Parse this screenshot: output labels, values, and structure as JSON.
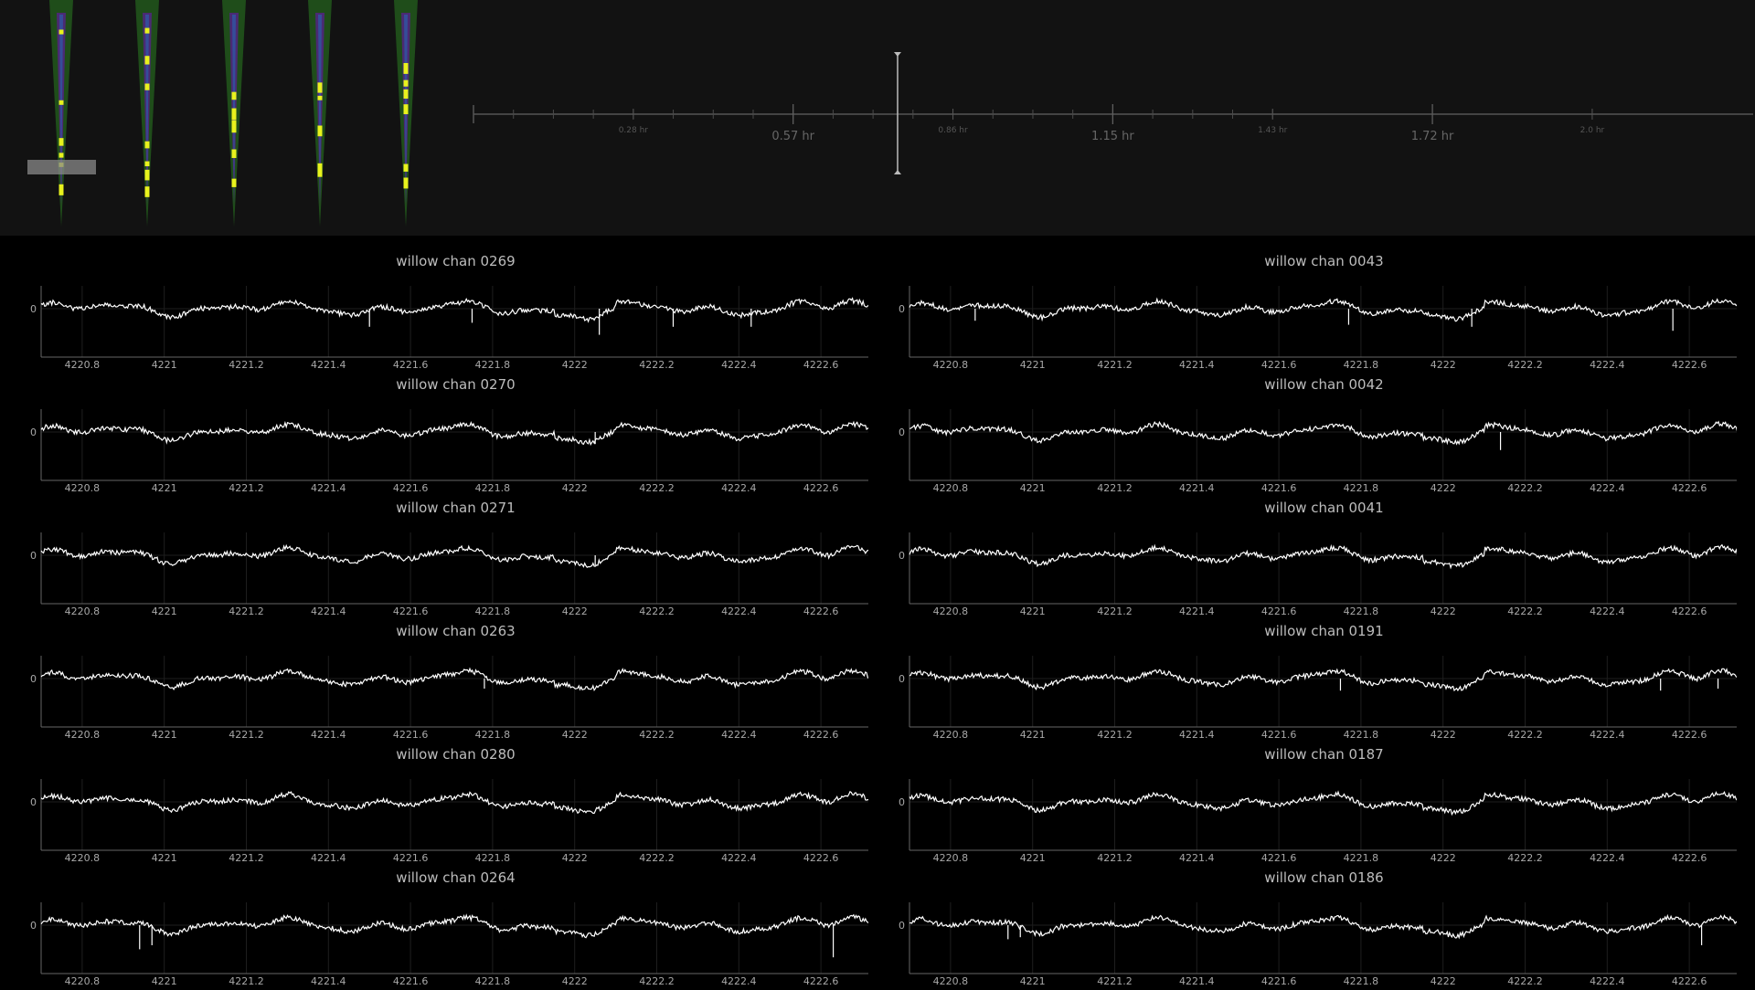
{
  "colors": {
    "background": "#000000",
    "top_panel": "#121212",
    "trace": "#ffffff",
    "axis": "#666666",
    "tick_text": "#a8a8a8",
    "probe_green": "#1f4d1a",
    "probe_purple": "#4b2a73",
    "probe_blue": "#2f56a3",
    "probe_yellow": "#e8f21d"
  },
  "probes": {
    "count": 5,
    "selection_box": true
  },
  "timeline": {
    "major_labels": [
      "0.57 hr",
      "1.15 hr",
      "1.72 hr"
    ],
    "minor_labels": [
      "0.28 hr",
      "0.86 hr",
      "1.43 hr",
      "2.0 hr"
    ],
    "cursor_value_hr": 0.76
  },
  "chart_data": [
    {
      "type": "line",
      "title": "willow chan 0269",
      "xlim": [
        4220.7,
        4222.72
      ],
      "ytick": "0",
      "x_ticks": [
        "4220.8",
        "4221",
        "4221.2",
        "4221.4",
        "4221.6",
        "4221.8",
        "4222",
        "4222.2",
        "4222.4",
        "4222.6"
      ],
      "seed": 11,
      "spikes": [
        [
          4221.5,
          0.9
        ],
        [
          4221.75,
          0.7
        ],
        [
          4222.06,
          1.3
        ],
        [
          4222.24,
          0.9
        ],
        [
          4222.43,
          0.9
        ]
      ]
    },
    {
      "type": "line",
      "title": "willow chan 0043",
      "xlim": [
        4220.7,
        4222.72
      ],
      "ytick": "0",
      "x_ticks": [
        "4220.8",
        "4221",
        "4221.2",
        "4221.4",
        "4221.6",
        "4221.8",
        "4222",
        "4222.2",
        "4222.4",
        "4222.6"
      ],
      "seed": 12,
      "spikes": [
        [
          4220.86,
          0.6
        ],
        [
          4221.77,
          0.8
        ],
        [
          4222.07,
          0.9
        ],
        [
          4222.56,
          1.1
        ]
      ]
    },
    {
      "type": "line",
      "title": "willow chan 0270",
      "xlim": [
        4220.7,
        4222.72
      ],
      "ytick": "0",
      "x_ticks": [
        "4220.8",
        "4221",
        "4221.2",
        "4221.4",
        "4221.6",
        "4221.8",
        "4222",
        "4222.2",
        "4222.4",
        "4222.6"
      ],
      "seed": 13,
      "spikes": [
        [
          4222.05,
          0.6
        ]
      ]
    },
    {
      "type": "line",
      "title": "willow chan 0042",
      "xlim": [
        4220.7,
        4222.72
      ],
      "ytick": "0",
      "x_ticks": [
        "4220.8",
        "4221",
        "4221.2",
        "4221.4",
        "4221.6",
        "4221.8",
        "4222",
        "4222.2",
        "4222.4",
        "4222.6"
      ],
      "seed": 14,
      "spikes": [
        [
          4222.14,
          0.9
        ]
      ]
    },
    {
      "type": "line",
      "title": "willow chan 0271",
      "xlim": [
        4220.7,
        4222.72
      ],
      "ytick": "0",
      "x_ticks": [
        "4220.8",
        "4221",
        "4221.2",
        "4221.4",
        "4221.6",
        "4221.8",
        "4222",
        "4222.2",
        "4222.4",
        "4222.6"
      ],
      "seed": 15,
      "spikes": [
        [
          4222.05,
          0.5
        ]
      ]
    },
    {
      "type": "line",
      "title": "willow chan 0041",
      "xlim": [
        4220.7,
        4222.72
      ],
      "ytick": "0",
      "x_ticks": [
        "4220.8",
        "4221",
        "4221.2",
        "4221.4",
        "4221.6",
        "4221.8",
        "4222",
        "4222.2",
        "4222.4",
        "4222.6"
      ],
      "seed": 16,
      "spikes": []
    },
    {
      "type": "line",
      "title": "willow chan 0263",
      "xlim": [
        4220.7,
        4222.72
      ],
      "ytick": "0",
      "x_ticks": [
        "4220.8",
        "4221",
        "4221.2",
        "4221.4",
        "4221.6",
        "4221.8",
        "4222",
        "4222.2",
        "4222.4",
        "4222.6"
      ],
      "seed": 17,
      "spikes": [
        [
          4221.78,
          0.5
        ]
      ]
    },
    {
      "type": "line",
      "title": "willow chan 0191",
      "xlim": [
        4220.7,
        4222.72
      ],
      "ytick": "0",
      "x_ticks": [
        "4220.8",
        "4221",
        "4221.2",
        "4221.4",
        "4221.6",
        "4221.8",
        "4222",
        "4222.2",
        "4222.4",
        "4222.6"
      ],
      "seed": 18,
      "spikes": [
        [
          4221.75,
          0.6
        ],
        [
          4222.53,
          0.6
        ],
        [
          4222.67,
          0.5
        ]
      ]
    },
    {
      "type": "line",
      "title": "willow chan 0280",
      "xlim": [
        4220.7,
        4222.72
      ],
      "ytick": "0",
      "x_ticks": [
        "4220.8",
        "4221",
        "4221.2",
        "4221.4",
        "4221.6",
        "4221.8",
        "4222",
        "4222.2",
        "4222.4",
        "4222.6"
      ],
      "seed": 19,
      "spikes": []
    },
    {
      "type": "line",
      "title": "willow chan 0187",
      "xlim": [
        4220.7,
        4222.72
      ],
      "ytick": "0",
      "x_ticks": [
        "4220.8",
        "4221",
        "4221.2",
        "4221.4",
        "4221.6",
        "4221.8",
        "4222",
        "4222.2",
        "4222.4",
        "4222.6"
      ],
      "seed": 20,
      "spikes": []
    },
    {
      "type": "line",
      "title": "willow chan 0264",
      "xlim": [
        4220.7,
        4222.72
      ],
      "ytick": "0",
      "x_ticks": [
        "4220.8",
        "4221",
        "4221.2",
        "4221.4",
        "4221.6",
        "4221.8",
        "4222",
        "4222.2",
        "4222.4",
        "4222.6"
      ],
      "seed": 21,
      "spikes": [
        [
          4220.94,
          1.2
        ],
        [
          4220.97,
          1.0
        ],
        [
          4222.63,
          1.6
        ]
      ]
    },
    {
      "type": "line",
      "title": "willow chan 0186",
      "xlim": [
        4220.7,
        4222.72
      ],
      "ytick": "0",
      "x_ticks": [
        "4220.8",
        "4221",
        "4221.2",
        "4221.4",
        "4221.6",
        "4221.8",
        "4222",
        "4222.2",
        "4222.4",
        "4222.6"
      ],
      "seed": 22,
      "spikes": [
        [
          4220.94,
          0.7
        ],
        [
          4220.97,
          0.6
        ],
        [
          4222.63,
          1.0
        ]
      ]
    }
  ]
}
